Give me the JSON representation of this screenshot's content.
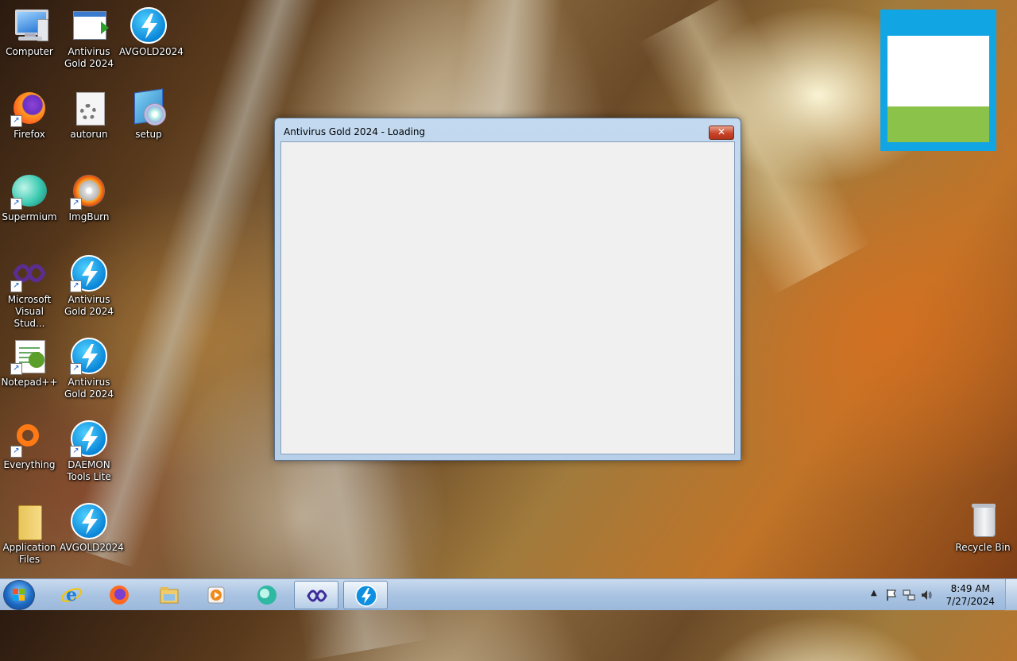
{
  "desktop": {
    "icons": [
      {
        "label": "Computer"
      },
      {
        "label": "Antivirus Gold 2024"
      },
      {
        "label": "AVGOLD2024"
      },
      {
        "label": "Firefox"
      },
      {
        "label": "autorun"
      },
      {
        "label": "setup"
      },
      {
        "label": "Supermium"
      },
      {
        "label": "ImgBurn"
      },
      {
        "label": "Microsoft Visual Stud..."
      },
      {
        "label": "Antivirus Gold 2024"
      },
      {
        "label": "Notepad++"
      },
      {
        "label": "Antivirus Gold 2024"
      },
      {
        "label": "Everything"
      },
      {
        "label": "DAEMON Tools Lite"
      },
      {
        "label": "Application Files"
      },
      {
        "label": "AVGOLD2024"
      },
      {
        "label": "Recycle Bin"
      }
    ]
  },
  "window": {
    "title": "Antivirus Gold 2024 - Loading",
    "close_glyph": "✕"
  },
  "widget": {
    "colors": {
      "frame": "#12a5e4",
      "top": "#ffffff",
      "bottom": "#8bc34a"
    }
  },
  "taskbar": {
    "pinned": [
      {
        "name": "start-button"
      },
      {
        "name": "internet-explorer-icon"
      },
      {
        "name": "firefox-icon"
      },
      {
        "name": "file-explorer-icon"
      },
      {
        "name": "media-player-icon"
      },
      {
        "name": "supermium-icon"
      },
      {
        "name": "visual-studio-icon",
        "active": true
      },
      {
        "name": "daemon-tools-icon",
        "active": true
      }
    ],
    "clock": {
      "time": "8:49 AM",
      "date": "7/27/2024"
    },
    "tray_icons": [
      "show-hidden-icons",
      "action-center-flag-icon",
      "network-icon",
      "volume-icon"
    ]
  }
}
